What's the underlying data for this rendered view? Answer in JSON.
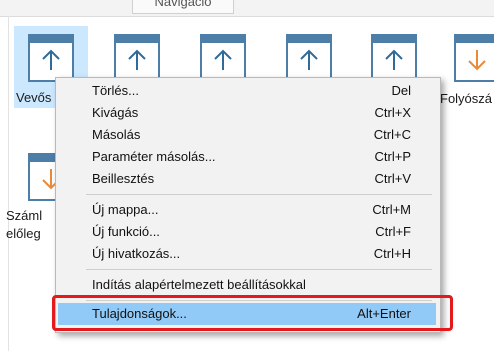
{
  "nav_tab": "Navigáció",
  "items": [
    {
      "label": "Vevős"
    },
    {
      "label": ""
    },
    {
      "label": ""
    },
    {
      "label": ""
    },
    {
      "label": ""
    },
    {
      "label": "Folyószá"
    },
    {
      "label": "Száml\nelőleg"
    }
  ],
  "menu": {
    "items": [
      {
        "label": "Törlés...",
        "shortcut": "Del"
      },
      {
        "label": "Kivágás",
        "shortcut": "Ctrl+X"
      },
      {
        "label": "Másolás",
        "shortcut": "Ctrl+C"
      },
      {
        "label": "Paraméter másolás...",
        "shortcut": "Ctrl+P"
      },
      {
        "label": "Beillesztés",
        "shortcut": "Ctrl+V"
      },
      {
        "label": "Új mappa...",
        "shortcut": "Ctrl+M"
      },
      {
        "label": "Új funkció...",
        "shortcut": "Ctrl+F"
      },
      {
        "label": "Új hivatkozás...",
        "shortcut": "Ctrl+H"
      },
      {
        "label": "Indítás alapértelmezett beállításokkal",
        "shortcut": ""
      },
      {
        "label": "Tulajdonságok...",
        "shortcut": "Alt+Enter"
      }
    ]
  },
  "colors": {
    "highlight_box": "#e3191c",
    "menu_hover": "#91c9f7",
    "selected_item": "#cce8ff",
    "icon": "#4d7ea8"
  }
}
